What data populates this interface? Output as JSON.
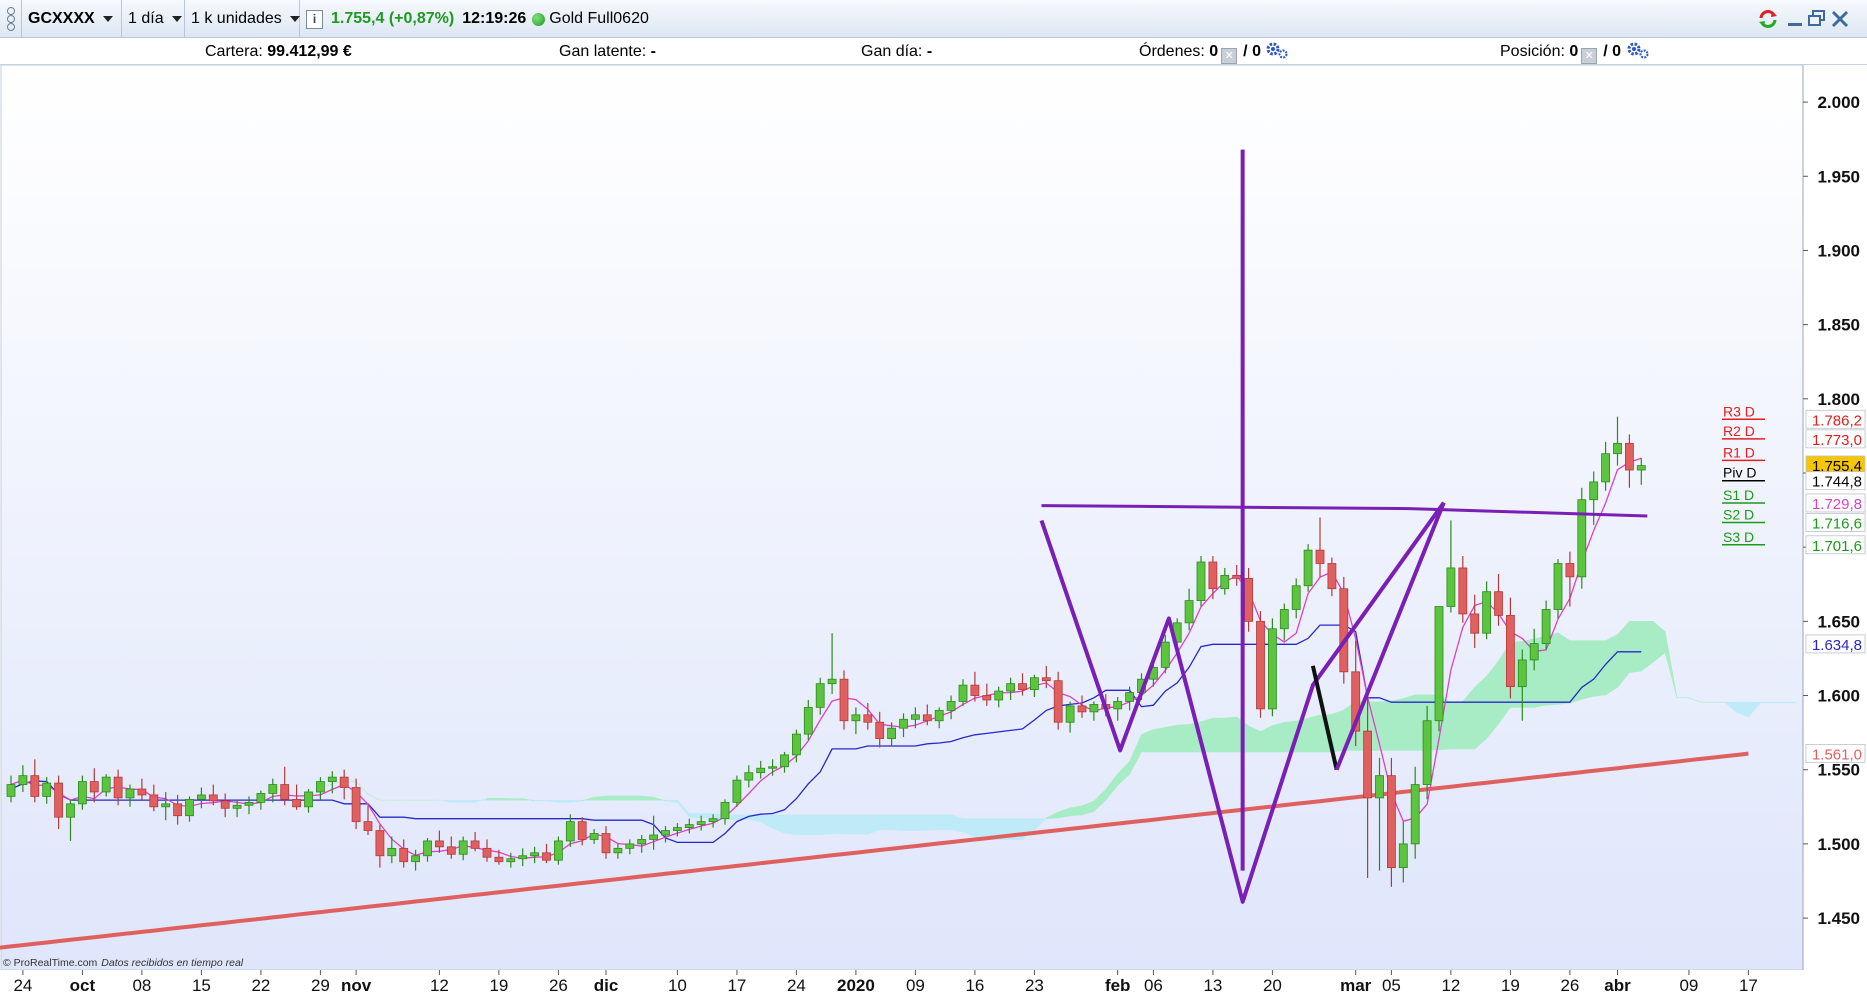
{
  "toolbar": {
    "symbol": "GCXXXX",
    "timeframe": "1 día",
    "units": "1 k unidades",
    "info_icon": "info-icon",
    "last_price": "1.755,4 (+0,87%)",
    "time": "12:19:26",
    "instrument": "Gold Full0620"
  },
  "status": {
    "cartera_label": "Cartera:",
    "cartera_value": "99.412,99 €",
    "gan_latente_label": "Gan latente:",
    "gan_latente_value": "-",
    "gan_dia_label": "Gan día:",
    "gan_dia_value": "-",
    "ordenes_label": "Órdenes:",
    "ordenes_value": "0",
    "ordenes_total": "/ 0",
    "posicion_label": "Posición:",
    "posicion_value": "0",
    "posicion_total": "/ 0"
  },
  "footer": {
    "copyright": "© ProRealTime.com",
    "realtime": "Datos recibidos en tiempo real"
  },
  "colors": {
    "up": "#5cc43f",
    "down": "#e06060",
    "pattern": "#7a1fb5",
    "sma": "#e06060",
    "fast_ma": "#e040c8",
    "kijun": "#2828c8",
    "cloud_bull": "#a7ecc4",
    "cloud_bear": "#bfeaf7",
    "price_tag": "#f7c600"
  },
  "chart_data": {
    "type": "candlestick",
    "ylim": [
      1415,
      2025
    ],
    "yticks": [
      1450,
      1500,
      1550,
      1600,
      1650,
      1700,
      1750,
      1800,
      1850,
      1900,
      1950,
      2000
    ],
    "ytick_labels": [
      "1.450",
      "1.500",
      "1.550",
      "1.600",
      "1.650",
      "",
      "",
      "1.800",
      "1.850",
      "1.900",
      "1.950",
      "2.000"
    ],
    "xlim": [
      0,
      150
    ],
    "xticks": [
      {
        "i": 1,
        "label": "24",
        "bold": false
      },
      {
        "i": 6,
        "label": "oct",
        "bold": true
      },
      {
        "i": 11,
        "label": "08",
        "bold": false
      },
      {
        "i": 16,
        "label": "15",
        "bold": false
      },
      {
        "i": 21,
        "label": "22",
        "bold": false
      },
      {
        "i": 26,
        "label": "29",
        "bold": false
      },
      {
        "i": 29,
        "label": "nov",
        "bold": true
      },
      {
        "i": 36,
        "label": "12",
        "bold": false
      },
      {
        "i": 41,
        "label": "19",
        "bold": false
      },
      {
        "i": 46,
        "label": "26",
        "bold": false
      },
      {
        "i": 50,
        "label": "dic",
        "bold": true
      },
      {
        "i": 56,
        "label": "10",
        "bold": false
      },
      {
        "i": 61,
        "label": "17",
        "bold": false
      },
      {
        "i": 66,
        "label": "24",
        "bold": false
      },
      {
        "i": 71,
        "label": "2020",
        "bold": true
      },
      {
        "i": 76,
        "label": "09",
        "bold": false
      },
      {
        "i": 81,
        "label": "16",
        "bold": false
      },
      {
        "i": 86,
        "label": "23",
        "bold": false
      },
      {
        "i": 93,
        "label": "feb",
        "bold": true
      },
      {
        "i": 96,
        "label": "06",
        "bold": false
      },
      {
        "i": 101,
        "label": "13",
        "bold": false
      },
      {
        "i": 106,
        "label": "20",
        "bold": false
      },
      {
        "i": 113,
        "label": "mar",
        "bold": true
      },
      {
        "i": 116,
        "label": "05",
        "bold": false
      },
      {
        "i": 121,
        "label": "12",
        "bold": false
      },
      {
        "i": 126,
        "label": "19",
        "bold": false
      },
      {
        "i": 131,
        "label": "26",
        "bold": false
      },
      {
        "i": 135,
        "label": "abr",
        "bold": true
      },
      {
        "i": 141,
        "label": "09",
        "bold": false
      },
      {
        "i": 146,
        "label": "17",
        "bold": false
      }
    ],
    "price_levels": [
      {
        "name": "R3 D",
        "value": 1786.2,
        "label": "1.786,2",
        "color": "#e02020"
      },
      {
        "name": "R2 D",
        "value": 1773.0,
        "label": "1.773,0",
        "color": "#e02020"
      },
      {
        "name": "R1 D",
        "value": 1758.5,
        "label": "",
        "color": "#e02020"
      },
      {
        "name": "Piv D",
        "value": 1744.8,
        "label": "1.744,8",
        "color": "#000000"
      },
      {
        "name": "S1 D",
        "value": 1729.8,
        "label": "1.729,8",
        "color": "#1a9a1a"
      },
      {
        "name": "S2 D",
        "value": 1716.6,
        "label": "1.716,6",
        "color": "#1a9a1a"
      },
      {
        "name": "S3 D",
        "value": 1701.6,
        "label": "1.701,6",
        "color": "#1a9a1a"
      }
    ],
    "right_tags": [
      {
        "value": 1786.2,
        "label": "1.786,2",
        "color": "#e02020",
        "bg": "#ffffff"
      },
      {
        "value": 1773.0,
        "label": "1.773,0",
        "color": "#e02020",
        "bg": "#ffffff"
      },
      {
        "value": 1755.4,
        "label": "1.755,4",
        "color": "#000000",
        "bg": "#f7c600"
      },
      {
        "value": 1744.8,
        "label": "1.744,8",
        "color": "#000000",
        "bg": "#ffffff"
      },
      {
        "value": 1729.8,
        "label": "1.729,8",
        "color": "#e040c8",
        "bg": "#ffffff"
      },
      {
        "value": 1716.6,
        "label": "1.716,6",
        "color": "#1a9a1a",
        "bg": "#ffffff"
      },
      {
        "value": 1701.6,
        "label": "1.701,6",
        "color": "#1a9a1a",
        "bg": "#ffffff"
      },
      {
        "value": 1634.8,
        "label": "1.634,8",
        "color": "#2828c8",
        "bg": "#ffffff"
      },
      {
        "value": 1561.0,
        "label": "1.561,0",
        "color": "#e06060",
        "bg": "#ffffff"
      }
    ],
    "candles": [
      [
        1532,
        1546,
        1528,
        1540
      ],
      [
        1540,
        1553,
        1535,
        1546
      ],
      [
        1546,
        1557,
        1528,
        1532
      ],
      [
        1532,
        1545,
        1527,
        1541
      ],
      [
        1541,
        1546,
        1510,
        1518
      ],
      [
        1518,
        1530,
        1502,
        1527
      ],
      [
        1527,
        1546,
        1523,
        1542
      ],
      [
        1542,
        1551,
        1528,
        1535
      ],
      [
        1535,
        1547,
        1532,
        1545
      ],
      [
        1545,
        1550,
        1526,
        1531
      ],
      [
        1531,
        1540,
        1525,
        1537
      ],
      [
        1537,
        1544,
        1529,
        1533
      ],
      [
        1533,
        1540,
        1522,
        1525
      ],
      [
        1525,
        1535,
        1516,
        1527
      ],
      [
        1527,
        1533,
        1513,
        1519
      ],
      [
        1519,
        1532,
        1515,
        1530
      ],
      [
        1530,
        1538,
        1524,
        1533
      ],
      [
        1533,
        1540,
        1526,
        1529
      ],
      [
        1529,
        1534,
        1518,
        1524
      ],
      [
        1524,
        1530,
        1518,
        1526
      ],
      [
        1526,
        1532,
        1520,
        1528
      ],
      [
        1528,
        1536,
        1523,
        1534
      ],
      [
        1534,
        1544,
        1528,
        1540
      ],
      [
        1540,
        1552,
        1526,
        1530
      ],
      [
        1530,
        1540,
        1523,
        1525
      ],
      [
        1525,
        1537,
        1521,
        1535
      ],
      [
        1535,
        1545,
        1530,
        1542
      ],
      [
        1542,
        1549,
        1534,
        1545
      ],
      [
        1545,
        1550,
        1530,
        1538
      ],
      [
        1538,
        1544,
        1510,
        1515
      ],
      [
        1515,
        1526,
        1506,
        1509
      ],
      [
        1509,
        1513,
        1484,
        1492
      ],
      [
        1492,
        1505,
        1487,
        1497
      ],
      [
        1497,
        1503,
        1484,
        1488
      ],
      [
        1488,
        1496,
        1482,
        1492
      ],
      [
        1492,
        1504,
        1488,
        1502
      ],
      [
        1502,
        1509,
        1494,
        1498
      ],
      [
        1498,
        1505,
        1490,
        1493
      ],
      [
        1493,
        1505,
        1489,
        1502
      ],
      [
        1502,
        1508,
        1495,
        1497
      ],
      [
        1497,
        1503,
        1488,
        1491
      ],
      [
        1491,
        1496,
        1486,
        1488
      ],
      [
        1488,
        1494,
        1484,
        1490
      ],
      [
        1490,
        1497,
        1485,
        1492
      ],
      [
        1492,
        1498,
        1487,
        1494
      ],
      [
        1494,
        1500,
        1487,
        1489
      ],
      [
        1489,
        1505,
        1486,
        1502
      ],
      [
        1502,
        1520,
        1498,
        1515
      ],
      [
        1515,
        1518,
        1499,
        1503
      ],
      [
        1503,
        1510,
        1500,
        1507
      ],
      [
        1507,
        1512,
        1490,
        1494
      ],
      [
        1494,
        1500,
        1490,
        1497
      ],
      [
        1497,
        1503,
        1493,
        1500
      ],
      [
        1500,
        1506,
        1494,
        1503
      ],
      [
        1503,
        1519,
        1496,
        1506
      ],
      [
        1506,
        1512,
        1501,
        1509
      ],
      [
        1509,
        1514,
        1505,
        1511
      ],
      [
        1511,
        1517,
        1507,
        1513
      ],
      [
        1513,
        1519,
        1509,
        1515
      ],
      [
        1515,
        1520,
        1511,
        1517
      ],
      [
        1517,
        1530,
        1513,
        1528
      ],
      [
        1528,
        1546,
        1525,
        1543
      ],
      [
        1543,
        1553,
        1538,
        1548
      ],
      [
        1548,
        1556,
        1544,
        1551
      ],
      [
        1551,
        1557,
        1546,
        1552
      ],
      [
        1552,
        1562,
        1548,
        1560
      ],
      [
        1560,
        1577,
        1555,
        1574
      ],
      [
        1574,
        1597,
        1570,
        1592
      ],
      [
        1592,
        1612,
        1587,
        1608
      ],
      [
        1608,
        1642,
        1601,
        1611
      ],
      [
        1611,
        1617,
        1577,
        1583
      ],
      [
        1583,
        1592,
        1574,
        1587
      ],
      [
        1587,
        1595,
        1577,
        1582
      ],
      [
        1582,
        1589,
        1565,
        1571
      ],
      [
        1571,
        1582,
        1566,
        1578
      ],
      [
        1578,
        1588,
        1572,
        1584
      ],
      [
        1584,
        1592,
        1578,
        1587
      ],
      [
        1587,
        1594,
        1580,
        1583
      ],
      [
        1583,
        1592,
        1578,
        1590
      ],
      [
        1590,
        1600,
        1584,
        1596
      ],
      [
        1596,
        1611,
        1593,
        1607
      ],
      [
        1607,
        1616,
        1596,
        1600
      ],
      [
        1600,
        1608,
        1593,
        1597
      ],
      [
        1597,
        1606,
        1592,
        1603
      ],
      [
        1603,
        1612,
        1597,
        1608
      ],
      [
        1608,
        1615,
        1600,
        1604
      ],
      [
        1604,
        1614,
        1599,
        1612
      ],
      [
        1612,
        1620,
        1605,
        1610
      ],
      [
        1610,
        1616,
        1577,
        1582
      ],
      [
        1582,
        1596,
        1575,
        1593
      ],
      [
        1593,
        1600,
        1585,
        1589
      ],
      [
        1589,
        1596,
        1583,
        1594
      ],
      [
        1594,
        1601,
        1586,
        1591
      ],
      [
        1591,
        1599,
        1583,
        1596
      ],
      [
        1596,
        1606,
        1590,
        1602
      ],
      [
        1602,
        1615,
        1597,
        1611
      ],
      [
        1611,
        1622,
        1606,
        1619
      ],
      [
        1619,
        1641,
        1615,
        1636
      ],
      [
        1636,
        1652,
        1629,
        1649
      ],
      [
        1649,
        1672,
        1644,
        1664
      ],
      [
        1664,
        1694,
        1660,
        1690
      ],
      [
        1690,
        1694,
        1665,
        1672
      ],
      [
        1672,
        1686,
        1668,
        1681
      ],
      [
        1681,
        1688,
        1674,
        1679
      ],
      [
        1679,
        1686,
        1643,
        1650
      ],
      [
        1650,
        1657,
        1585,
        1591
      ],
      [
        1591,
        1652,
        1586,
        1645
      ],
      [
        1645,
        1662,
        1637,
        1658
      ],
      [
        1658,
        1679,
        1652,
        1674
      ],
      [
        1674,
        1702,
        1670,
        1698
      ],
      [
        1698,
        1720,
        1680,
        1689
      ],
      [
        1689,
        1693,
        1667,
        1672
      ],
      [
        1672,
        1680,
        1608,
        1616
      ],
      [
        1616,
        1637,
        1566,
        1576
      ],
      [
        1576,
        1600,
        1477,
        1531
      ],
      [
        1531,
        1558,
        1482,
        1546
      ],
      [
        1546,
        1558,
        1471,
        1484
      ],
      [
        1484,
        1515,
        1474,
        1500
      ],
      [
        1500,
        1552,
        1490,
        1540
      ],
      [
        1540,
        1593,
        1530,
        1583
      ],
      [
        1583,
        1660,
        1576,
        1660
      ],
      [
        1660,
        1718,
        1656,
        1686
      ],
      [
        1686,
        1694,
        1649,
        1655
      ],
      [
        1655,
        1668,
        1632,
        1642
      ],
      [
        1642,
        1677,
        1638,
        1670
      ],
      [
        1670,
        1682,
        1647,
        1654
      ],
      [
        1654,
        1666,
        1598,
        1606
      ],
      [
        1606,
        1631,
        1583,
        1624
      ],
      [
        1624,
        1645,
        1617,
        1635
      ],
      [
        1635,
        1664,
        1631,
        1658
      ],
      [
        1658,
        1692,
        1652,
        1689
      ],
      [
        1689,
        1697,
        1660,
        1680
      ],
      [
        1680,
        1740,
        1672,
        1732
      ],
      [
        1732,
        1751,
        1715,
        1744
      ],
      [
        1744,
        1771,
        1738,
        1763
      ],
      [
        1763,
        1788,
        1755,
        1770
      ],
      [
        1770,
        1776,
        1740,
        1752
      ],
      [
        1752,
        1760,
        1742,
        1755
      ]
    ]
  }
}
